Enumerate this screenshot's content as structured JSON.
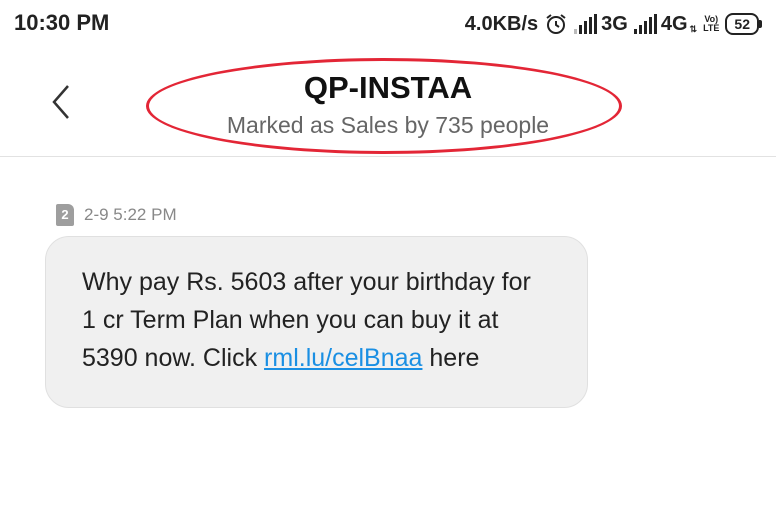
{
  "status_bar": {
    "time": "10:30 PM",
    "net_speed": "4.0KB/s",
    "network1": "3G",
    "network2": "4G",
    "network2_sub": "⇅",
    "volte_top": "Vo)",
    "volte_bottom": "LTE",
    "battery": "52",
    "icons": [
      "alarm-icon",
      "signal-icon",
      "signal-icon",
      "volte-icon",
      "battery-icon"
    ]
  },
  "header": {
    "title": "QP-INSTAA",
    "subtitle": "Marked as Sales by 735 people",
    "annotation_color": "#e32636"
  },
  "message": {
    "sim_slot": "2",
    "timestamp": "2-9 5:22 PM",
    "text_before": "Why pay Rs. 5603 after your birthday for 1 cr Term Plan when you can buy it at 5390 now. Click ",
    "link": "rml.lu/celBnaa",
    "text_after": " here",
    "link_color": "#1a8fe3"
  }
}
